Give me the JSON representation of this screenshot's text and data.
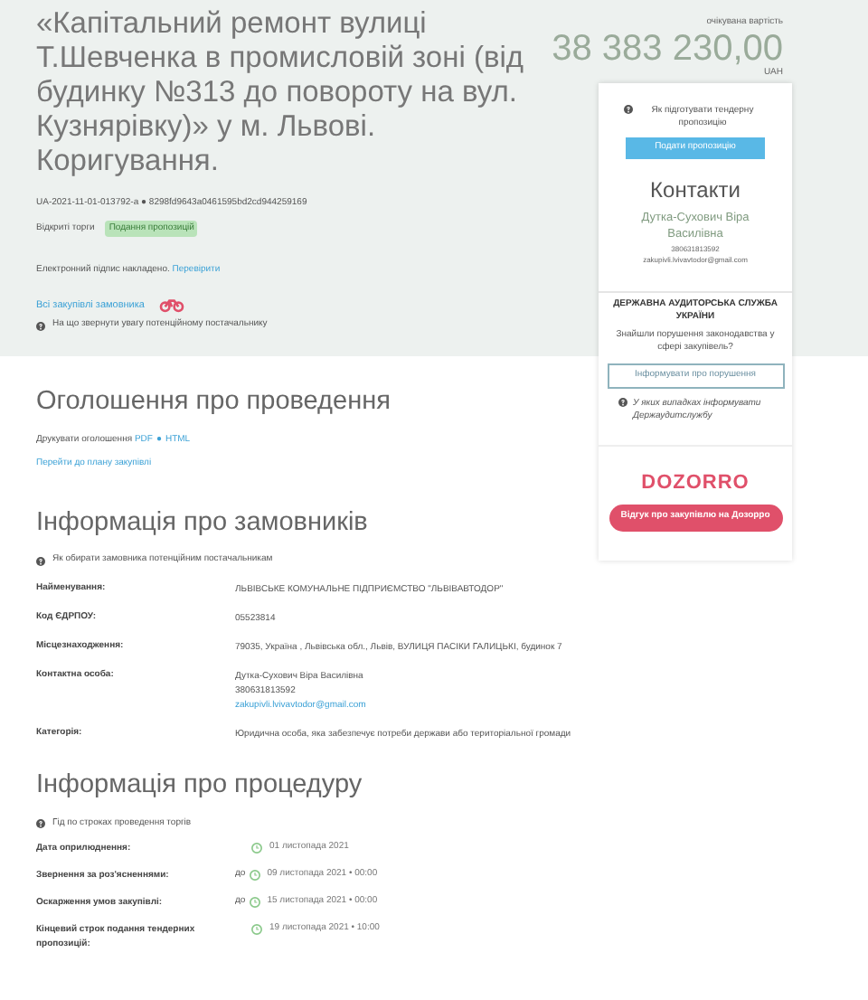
{
  "tender": {
    "title": "«Капітальний ремонт вулиці Т.Шевченка в промисловій зоні (від будинку №313 до повороту на вул. Кузнярівку)» у м. Львові. Коригування.",
    "id": "UA-2021-11-01-013792-a ● 8298fd9643a0461595bd2cd944259169",
    "procedure_type": "Відкриті торги",
    "status": "Подання пропозицій",
    "signature": "Електронний підпис накладено.",
    "signature_link": "Перевірити",
    "all_purchases_link": "Всі закупівлі замовника",
    "hint": "На що звернути увагу потенційному постачальнику"
  },
  "price": {
    "label": "очікувана вартість",
    "amount": "38 383 230,00",
    "currency": "UAH"
  },
  "sidebar": {
    "howto": "Як підготувати тендерну пропозицію",
    "submit_button": "Подати пропозицію",
    "contacts_title": "Контакти",
    "contact_name": "Дутка-Сухович Віра Василівна",
    "contact_phone": "380631813592",
    "contact_email": "zakupivli.lvivavtodor@gmail.com",
    "audit_title": "ДЕРЖАВНА АУДИТОРСЬКА СЛУЖБА УКРАЇНИ",
    "audit_question": "Знайшли порушення законодавства у сфері закупівель?",
    "audit_button": "Інформувати про порушення",
    "audit_hint": "У яких випадках інформувати Держаудитслужбу",
    "dozorro_logo": "DOZORRO",
    "dozorro_button": "Відгук про закупівлю на Дозорро"
  },
  "announcement": {
    "title": "Оголошення про проведення",
    "print_label": "Друкувати оголошення",
    "print_links": [
      "PDF",
      "HTML"
    ],
    "print_separator": "●",
    "plan_link": "Перейти до плану закупівлі"
  },
  "customer": {
    "title": "Інформація про замовників",
    "hint": "Як обирати замовника потенційним постачальникам",
    "rows": [
      {
        "label": "Найменування:",
        "lines": [
          "ЛЬВІВСЬКЕ КОМУНАЛЬНЕ ПІДПРИЄМСТВО \"ЛЬВІВАВТОДОР\""
        ]
      },
      {
        "label": "Код ЄДРПОУ:",
        "lines": [
          "05523814"
        ]
      },
      {
        "label": "Місцезнаходження:",
        "lines": [
          "79035, Україна , Львівська обл., Львів, ВУЛИЦЯ ПАСІКИ ГАЛИЦЬКІ, будинок 7"
        ]
      },
      {
        "label": "Контактна особа:",
        "lines": [
          "Дутка-Сухович Віра Василівна",
          "380631813592"
        ],
        "email": "zakupivli.lvivavtodor@gmail.com"
      },
      {
        "label": "Категорія:",
        "lines": [
          "Юридична особа, яка забезпечує потреби держави або територіальної громади"
        ]
      }
    ]
  },
  "procedure": {
    "title": "Інформація про процедуру",
    "hint": "Гід по строках проведення торгів",
    "rows": [
      {
        "label": "Дата оприлюднення:",
        "date": "01 листопада 2021"
      },
      {
        "label": "Звернення за роз'ясненнями:",
        "prefix": "до",
        "date": "09 листопада 2021 • 00:00"
      },
      {
        "label": "Оскарження умов закупівлі:",
        "prefix": "до",
        "date": "15 листопада 2021 • 00:00"
      },
      {
        "label": "Кінцевий строк подання тендерних пропозицій:",
        "date": "19 листопада 2021 • 10:00"
      }
    ]
  }
}
